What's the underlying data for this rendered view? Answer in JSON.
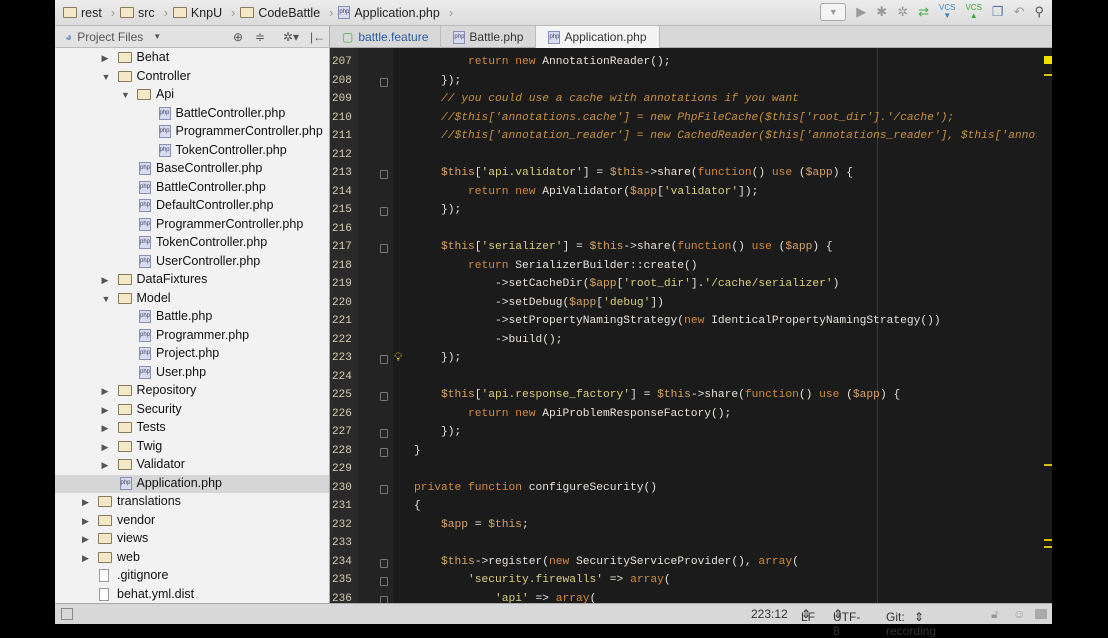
{
  "breadcrumb": [
    "rest",
    "src",
    "KnpU",
    "CodeBattle",
    "Application.php"
  ],
  "toolbar": {
    "icons": [
      "run-config-dropdown",
      "run-icon",
      "debug-icon",
      "coverage-icon",
      "sync-icon",
      "vcs-update-icon",
      "vcs-commit-icon",
      "compare-icon",
      "undo-icon",
      "search-icon"
    ],
    "vcs_label": "VCS"
  },
  "project_view": {
    "label": "Project Files"
  },
  "tabs": [
    {
      "label": "battle.feature"
    },
    {
      "label": "Battle.php"
    },
    {
      "label": "Application.php",
      "active": true
    }
  ],
  "tree": [
    {
      "d": 1,
      "t": "dir",
      "o": false,
      "label": "Behat"
    },
    {
      "d": 1,
      "t": "dir",
      "o": true,
      "label": "Controller"
    },
    {
      "d": 2,
      "t": "dir",
      "o": true,
      "label": "Api"
    },
    {
      "d": 3,
      "t": "php",
      "label": "BattleController.php"
    },
    {
      "d": 3,
      "t": "php",
      "label": "ProgrammerController.php"
    },
    {
      "d": 3,
      "t": "php",
      "label": "TokenController.php"
    },
    {
      "d": 2,
      "t": "php",
      "label": "BaseController.php"
    },
    {
      "d": 2,
      "t": "php",
      "label": "BattleController.php"
    },
    {
      "d": 2,
      "t": "php",
      "label": "DefaultController.php"
    },
    {
      "d": 2,
      "t": "php",
      "label": "ProgrammerController.php"
    },
    {
      "d": 2,
      "t": "php",
      "label": "TokenController.php"
    },
    {
      "d": 2,
      "t": "php",
      "label": "UserController.php"
    },
    {
      "d": 1,
      "t": "dir",
      "o": false,
      "label": "DataFixtures"
    },
    {
      "d": 1,
      "t": "dir",
      "o": true,
      "label": "Model"
    },
    {
      "d": 2,
      "t": "php",
      "label": "Battle.php"
    },
    {
      "d": 2,
      "t": "php",
      "label": "Programmer.php"
    },
    {
      "d": 2,
      "t": "php",
      "label": "Project.php"
    },
    {
      "d": 2,
      "t": "php",
      "label": "User.php"
    },
    {
      "d": 1,
      "t": "dir",
      "o": false,
      "label": "Repository"
    },
    {
      "d": 1,
      "t": "dir",
      "o": false,
      "label": "Security"
    },
    {
      "d": 1,
      "t": "dir",
      "o": false,
      "label": "Tests"
    },
    {
      "d": 1,
      "t": "dir",
      "o": false,
      "label": "Twig"
    },
    {
      "d": 1,
      "t": "dir",
      "o": false,
      "label": "Validator"
    },
    {
      "d": 1,
      "t": "php",
      "label": "Application.php",
      "selected": true
    },
    {
      "d": 0,
      "t": "dir",
      "o": false,
      "label": "translations"
    },
    {
      "d": 0,
      "t": "dir",
      "o": false,
      "label": "vendor"
    },
    {
      "d": 0,
      "t": "dir",
      "o": false,
      "label": "views"
    },
    {
      "d": 0,
      "t": "dir",
      "o": false,
      "label": "web"
    },
    {
      "d": 0,
      "t": "file",
      "label": ".gitignore"
    },
    {
      "d": 0,
      "t": "file",
      "label": "behat.yml.dist"
    }
  ],
  "code": [
    {
      "n": "207",
      "t": [
        [
          "k",
          "            return new "
        ],
        [
          "p",
          "AnnotationReader();"
        ]
      ]
    },
    {
      "n": "208",
      "f": 1,
      "t": [
        [
          "p",
          "        });"
        ]
      ]
    },
    {
      "n": "209",
      "t": [
        [
          "c",
          "        // you could use a cache with annotations if you want"
        ]
      ]
    },
    {
      "n": "210",
      "t": [
        [
          "c",
          "        //$this['annotations.cache'] = new PhpFileCache($this['root_dir'].'/cache');"
        ]
      ]
    },
    {
      "n": "211",
      "t": [
        [
          "c",
          "        //$this['annotation_reader'] = new CachedReader($this['annotations_reader'], $this['annotations.cache']"
        ]
      ]
    },
    {
      "n": "212",
      "t": []
    },
    {
      "n": "213",
      "f": 1,
      "t": [
        [
          "v",
          "        $this"
        ],
        [
          "p",
          "["
        ],
        [
          "s",
          "'api.validator'"
        ],
        [
          "p",
          "] = "
        ],
        [
          "v",
          "$this"
        ],
        [
          "p",
          "->share("
        ],
        [
          "k",
          "function"
        ],
        [
          "p",
          "() "
        ],
        [
          "k",
          "use"
        ],
        [
          "p",
          " ("
        ],
        [
          "v",
          "$app"
        ],
        [
          "p",
          ") {"
        ]
      ]
    },
    {
      "n": "214",
      "t": [
        [
          "k",
          "            return new "
        ],
        [
          "p",
          "ApiValidator("
        ],
        [
          "v",
          "$app"
        ],
        [
          "p",
          "["
        ],
        [
          "s",
          "'validator'"
        ],
        [
          "p",
          "]);"
        ]
      ]
    },
    {
      "n": "215",
      "f": 1,
      "t": [
        [
          "p",
          "        });"
        ]
      ]
    },
    {
      "n": "216",
      "t": []
    },
    {
      "n": "217",
      "f": 1,
      "t": [
        [
          "v",
          "        $this"
        ],
        [
          "p",
          "["
        ],
        [
          "s",
          "'serializer'"
        ],
        [
          "p",
          "] = "
        ],
        [
          "v",
          "$this"
        ],
        [
          "p",
          "->share("
        ],
        [
          "k",
          "function"
        ],
        [
          "p",
          "() "
        ],
        [
          "k",
          "use"
        ],
        [
          "p",
          " ("
        ],
        [
          "v",
          "$app"
        ],
        [
          "p",
          ") {"
        ]
      ]
    },
    {
      "n": "218",
      "t": [
        [
          "k",
          "            return "
        ],
        [
          "p",
          "SerializerBuilder::create()"
        ]
      ]
    },
    {
      "n": "219",
      "t": [
        [
          "p",
          "                ->setCacheDir("
        ],
        [
          "v",
          "$app"
        ],
        [
          "p",
          "["
        ],
        [
          "s",
          "'root_dir'"
        ],
        [
          "p",
          "]."
        ],
        [
          "s",
          "'/cache/serializer'"
        ],
        [
          "p",
          ")"
        ]
      ]
    },
    {
      "n": "220",
      "t": [
        [
          "p",
          "                ->setDebug("
        ],
        [
          "v",
          "$app"
        ],
        [
          "p",
          "["
        ],
        [
          "s",
          "'debug'"
        ],
        [
          "p",
          "])"
        ]
      ]
    },
    {
      "n": "221",
      "t": [
        [
          "p",
          "                ->setPropertyNamingStrategy("
        ],
        [
          "k",
          "new "
        ],
        [
          "p",
          "IdenticalPropertyNamingStrategy())"
        ]
      ]
    },
    {
      "n": "222",
      "t": [
        [
          "p",
          "                ->build();"
        ]
      ]
    },
    {
      "n": "223",
      "f": 1,
      "b": 1,
      "t": [
        [
          "p",
          "        });"
        ]
      ]
    },
    {
      "n": "224",
      "t": []
    },
    {
      "n": "225",
      "f": 1,
      "t": [
        [
          "v",
          "        $this"
        ],
        [
          "p",
          "["
        ],
        [
          "s",
          "'api.response_factory'"
        ],
        [
          "p",
          "] = "
        ],
        [
          "v",
          "$this"
        ],
        [
          "p",
          "->share("
        ],
        [
          "k",
          "function"
        ],
        [
          "p",
          "() "
        ],
        [
          "k",
          "use"
        ],
        [
          "p",
          " ("
        ],
        [
          "v",
          "$app"
        ],
        [
          "p",
          ") {"
        ]
      ]
    },
    {
      "n": "226",
      "t": [
        [
          "k",
          "            return new "
        ],
        [
          "p",
          "ApiProblemResponseFactory();"
        ]
      ]
    },
    {
      "n": "227",
      "f": 1,
      "t": [
        [
          "p",
          "        });"
        ]
      ]
    },
    {
      "n": "228",
      "f": 1,
      "t": [
        [
          "p",
          "    }"
        ]
      ]
    },
    {
      "n": "229",
      "t": []
    },
    {
      "n": "230",
      "f": 1,
      "t": [
        [
          "k",
          "    private function "
        ],
        [
          "p",
          "configureSecurity()"
        ]
      ]
    },
    {
      "n": "231",
      "t": [
        [
          "p",
          "    {"
        ]
      ]
    },
    {
      "n": "232",
      "t": [
        [
          "v",
          "        $app"
        ],
        [
          "p",
          " = "
        ],
        [
          "v",
          "$this"
        ],
        [
          "p",
          ";"
        ]
      ]
    },
    {
      "n": "233",
      "t": []
    },
    {
      "n": "234",
      "f": 1,
      "t": [
        [
          "v",
          "        $this"
        ],
        [
          "p",
          "->register("
        ],
        [
          "k",
          "new "
        ],
        [
          "p",
          "SecurityServiceProvider(), "
        ],
        [
          "k",
          "array"
        ],
        [
          "p",
          "("
        ]
      ]
    },
    {
      "n": "235",
      "f": 1,
      "t": [
        [
          "s",
          "            'security.firewalls'"
        ],
        [
          "p",
          " => "
        ],
        [
          "k",
          "array"
        ],
        [
          "p",
          "("
        ]
      ]
    },
    {
      "n": "236",
      "f": 1,
      "t": [
        [
          "s",
          "                'api'"
        ],
        [
          "p",
          " => "
        ],
        [
          "k",
          "array"
        ],
        [
          "p",
          "("
        ]
      ]
    }
  ],
  "status": {
    "position": "223:12",
    "line_ending": "LF",
    "encoding": "UTF-8",
    "vcs": "Git: recording"
  },
  "colors": {
    "keyword": "#d38a3a",
    "string": "#d9cf7a",
    "comment": "#c79042",
    "background": "#1b1b1b"
  }
}
